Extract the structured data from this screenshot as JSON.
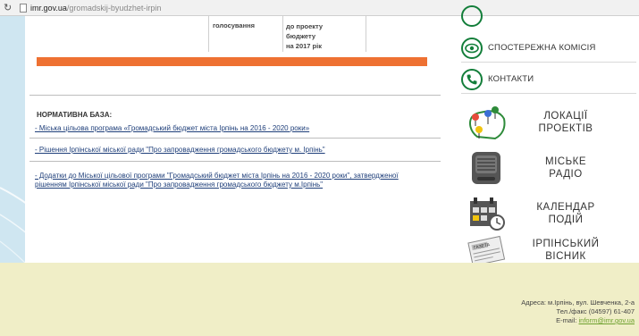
{
  "browser": {
    "domain": "imr.gov.ua",
    "path": "/gromadskij-byudzhet-irpin"
  },
  "vote_table": {
    "col1": "голосування",
    "col2_lines": [
      "до проекту",
      "бюджету",
      "на 2017 рік"
    ]
  },
  "normative": {
    "title": "НОРМАТИВНА БАЗА:",
    "links": [
      "- Міська цільова програма «Громадський бюджет міста Ірпінь на 2016 - 2020 роки»",
      "- Рішення Ірпінської міської ради \"Про запровадження громадського бюджету м. Ірпінь\"",
      "- Додатки до Міської цільової програми \"Громадський бюджет міста Ірпінь на 2016 - 2020 роки\", затвердженої рішенням Ірпінської міської ради \"Про запровадження громадського бюджету м.Ірпінь\""
    ]
  },
  "sidebar": {
    "menu": [
      {
        "label": "СПОСТЕРЕЖНА КОМІСІЯ",
        "icon": "eye-icon"
      },
      {
        "label": "КОНТАКТИ",
        "icon": "phone-icon"
      }
    ],
    "tiles": [
      {
        "title_lines": [
          "ЛОКАЦІЇ",
          "ПРОЕКТІВ"
        ],
        "icon": "map-pins-icon"
      },
      {
        "title_lines": [
          "МІСЬКЕ",
          "РАДІО"
        ],
        "icon": "radio-icon"
      },
      {
        "title_lines": [
          "КАЛЕНДАР",
          "ПОДІЙ"
        ],
        "icon": "calendar-icon"
      },
      {
        "title_lines": [
          "ІРПІНСЬКИЙ",
          "ВІСНИК"
        ],
        "icon": "newspaper-icon",
        "badge": "ГАЗЕТА"
      }
    ]
  },
  "footer": {
    "address": "Адреса: м.Ірпінь, вул. Шевченка, 2-а",
    "phone": "Тел./факс (04597) 61-407",
    "email_label": "E-mail:",
    "email": "inform@imr.gov.ua"
  },
  "colors": {
    "accent_orange": "#ee7132",
    "green": "#137e3a",
    "link": "#1f3f7a"
  }
}
